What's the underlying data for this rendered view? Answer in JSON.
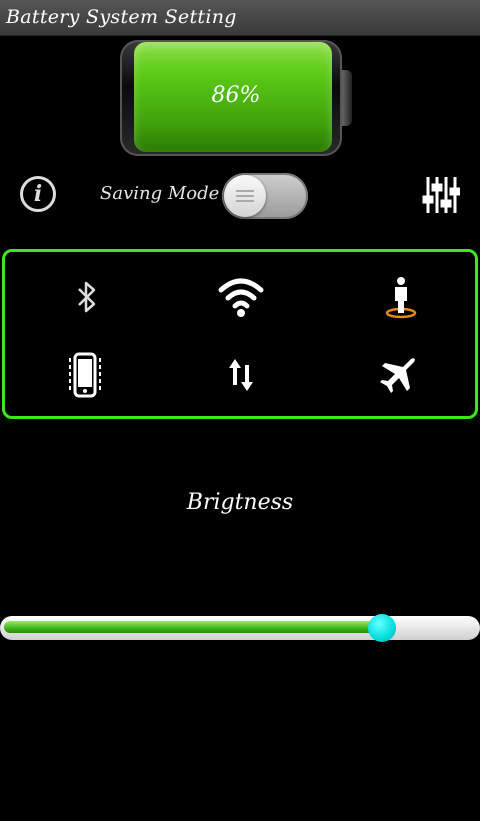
{
  "app": {
    "title": "Battery System Setting"
  },
  "battery": {
    "level_text": "86%",
    "level": 0.86,
    "fill_color": "#5ac916"
  },
  "controls": {
    "info_icon": "info-icon",
    "info_label": "i",
    "saving_mode_label": "Saving Mode",
    "saving_mode_on": false,
    "settings_icon": "equalizer-icon"
  },
  "quick_settings": {
    "border_color": "#3ee81c",
    "items": [
      {
        "icon": "bluetooth-icon"
      },
      {
        "icon": "wifi-icon"
      },
      {
        "icon": "person-icon"
      },
      {
        "icon": "vibrate-phone-icon"
      },
      {
        "icon": "data-sync-icon"
      },
      {
        "icon": "airplane-icon"
      }
    ]
  },
  "brightness": {
    "label": "Brigtness",
    "value": 0.83,
    "thumb_color": "#00e0e0"
  }
}
